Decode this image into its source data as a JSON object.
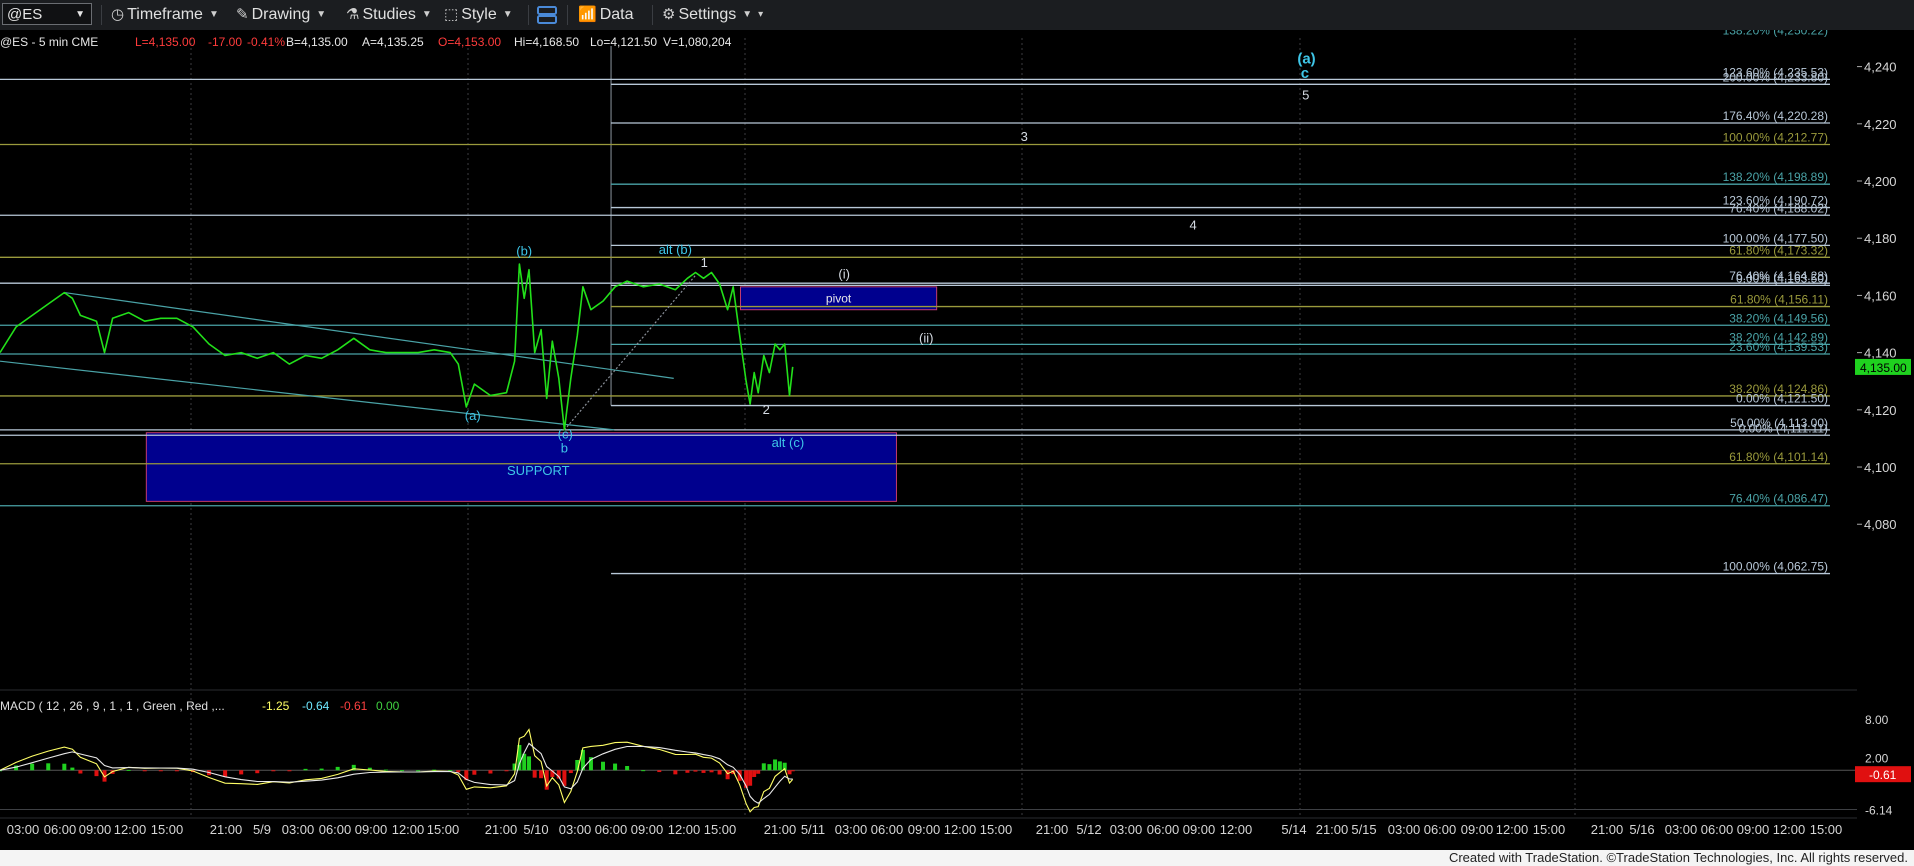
{
  "toolbar": {
    "symbol": "@ES",
    "items": [
      {
        "label": "Timeframe",
        "icon": "clock-icon",
        "has_caret": true
      },
      {
        "label": "Drawing",
        "icon": "pencil-icon",
        "has_caret": true
      },
      {
        "label": "Studies",
        "icon": "flask-icon",
        "has_caret": true
      },
      {
        "label": "Style",
        "icon": "style-icon",
        "has_caret": true
      },
      {
        "label": "",
        "icon": "layout-icon",
        "has_caret": false
      },
      {
        "label": "Data",
        "icon": "bar-chart-icon",
        "has_caret": false
      },
      {
        "label": "Settings",
        "icon": "gear-icon",
        "has_caret": true
      }
    ]
  },
  "header": {
    "symbol_info": "@ES - 5 min  CME",
    "L": "L=4,135.00",
    "chg": "-17.00",
    "pct": "-0.41%",
    "B": "B=4,135.00",
    "A": "A=4,135.25",
    "O": "O=4,153.00",
    "Hi": "Hi=4,168.50",
    "Lo": "Lo=4,121.50",
    "V": "V=1,080,204"
  },
  "colors": {
    "price": "#22e01a",
    "wave_label": "#3ec6e8",
    "box_fill": "#00008e",
    "box_border": "#c43b6e",
    "fib_olive": "#9a9a3c",
    "fib_teal": "#4aa3a7",
    "fib_white": "#b8c8d8",
    "last_price_bg": "#1fd11f",
    "macd_neg_bg": "#e01010"
  },
  "chart_data": {
    "type": "line",
    "instrument": "@ES - 5 min CME",
    "ylim": [
      4062,
      4246
    ],
    "y_ticks": [
      4080,
      4100,
      4120,
      4140,
      4160,
      4180,
      4200,
      4220,
      4240
    ],
    "last_price": "4,135.00",
    "x_tick_labels": [
      "03:00",
      "06:00",
      "09:00",
      "12:00",
      "15:00",
      "21:00",
      "5/9",
      "03:00",
      "06:00",
      "09:00",
      "12:00",
      "15:00",
      "21:00",
      "5/10",
      "03:00",
      "06:00",
      "09:00",
      "12:00",
      "15:00",
      "21:00",
      "5/11",
      "03:00",
      "06:00",
      "09:00",
      "12:00",
      "15:00",
      "21:00",
      "5/12",
      "03:00",
      "06:00",
      "09:00",
      "12:00",
      "5/14",
      "21:00",
      "5/15",
      "03:00",
      "06:00",
      "09:00",
      "12:00",
      "15:00",
      "21:00",
      "5/16",
      "03:00",
      "06:00",
      "09:00",
      "12:00",
      "15:00"
    ],
    "price_path": [
      {
        "t": 0,
        "p": 4140
      },
      {
        "t": 2,
        "p": 4149
      },
      {
        "t": 4,
        "p": 4153
      },
      {
        "t": 6,
        "p": 4157
      },
      {
        "t": 8,
        "p": 4161
      },
      {
        "t": 9,
        "p": 4159
      },
      {
        "t": 10,
        "p": 4153
      },
      {
        "t": 12,
        "p": 4151
      },
      {
        "t": 13,
        "p": 4140
      },
      {
        "t": 14,
        "p": 4152
      },
      {
        "t": 16,
        "p": 4154
      },
      {
        "t": 18,
        "p": 4151
      },
      {
        "t": 20,
        "p": 4152
      },
      {
        "t": 22,
        "p": 4152
      },
      {
        "t": 24,
        "p": 4149
      },
      {
        "t": 26,
        "p": 4143
      },
      {
        "t": 28,
        "p": 4139
      },
      {
        "t": 30,
        "p": 4140
      },
      {
        "t": 32,
        "p": 4138
      },
      {
        "t": 34,
        "p": 4140
      },
      {
        "t": 36,
        "p": 4136
      },
      {
        "t": 38,
        "p": 4139
      },
      {
        "t": 40,
        "p": 4138
      },
      {
        "t": 42,
        "p": 4141
      },
      {
        "t": 44,
        "p": 4145
      },
      {
        "t": 46,
        "p": 4141
      },
      {
        "t": 48,
        "p": 4140
      },
      {
        "t": 50,
        "p": 4140
      },
      {
        "t": 52,
        "p": 4140
      },
      {
        "t": 54,
        "p": 4141
      },
      {
        "t": 56,
        "p": 4140
      },
      {
        "t": 57,
        "p": 4136
      },
      {
        "t": 58,
        "p": 4121
      },
      {
        "t": 59,
        "p": 4129
      },
      {
        "t": 61,
        "p": 4125
      },
      {
        "t": 63,
        "p": 4126
      },
      {
        "t": 64,
        "p": 4137
      },
      {
        "t": 64.6,
        "p": 4171
      },
      {
        "t": 65.2,
        "p": 4159
      },
      {
        "t": 65.8,
        "p": 4169
      },
      {
        "t": 66.5,
        "p": 4140
      },
      {
        "t": 67.3,
        "p": 4148
      },
      {
        "t": 68,
        "p": 4124
      },
      {
        "t": 68.7,
        "p": 4144
      },
      {
        "t": 69.5,
        "p": 4131
      },
      {
        "t": 70.2,
        "p": 4113
      },
      {
        "t": 71,
        "p": 4131
      },
      {
        "t": 71.8,
        "p": 4146
      },
      {
        "t": 72.5,
        "p": 4163
      },
      {
        "t": 73.5,
        "p": 4155
      },
      {
        "t": 75,
        "p": 4158
      },
      {
        "t": 76.5,
        "p": 4163
      },
      {
        "t": 78,
        "p": 4165
      },
      {
        "t": 80,
        "p": 4163
      },
      {
        "t": 82,
        "p": 4164
      },
      {
        "t": 84,
        "p": 4162
      },
      {
        "t": 85.5,
        "p": 4166
      },
      {
        "t": 86.5,
        "p": 4168
      },
      {
        "t": 87.5,
        "p": 4166
      },
      {
        "t": 88.5,
        "p": 4168
      },
      {
        "t": 89.5,
        "p": 4164
      },
      {
        "t": 90.5,
        "p": 4155
      },
      {
        "t": 91.2,
        "p": 4163
      },
      {
        "t": 92,
        "p": 4146
      },
      {
        "t": 92.8,
        "p": 4130
      },
      {
        "t": 93.3,
        "p": 4122
      },
      {
        "t": 93.8,
        "p": 4133
      },
      {
        "t": 94.3,
        "p": 4126
      },
      {
        "t": 95,
        "p": 4139
      },
      {
        "t": 95.7,
        "p": 4133
      },
      {
        "t": 96.4,
        "p": 4143
      },
      {
        "t": 97,
        "p": 4141
      },
      {
        "t": 97.6,
        "p": 4143
      },
      {
        "t": 98.2,
        "p": 4125
      },
      {
        "t": 98.6,
        "p": 4135
      }
    ],
    "fib_levels": [
      {
        "label": "138.20% (4,250.22)",
        "value": 4250.22,
        "color": "teal",
        "x_from": 76
      },
      {
        "label": "123.60% (4,235.53)",
        "value": 4235.53,
        "color": "white",
        "x_from": 0
      },
      {
        "label": "200.00% (4,233.80)",
        "value": 4233.8,
        "color": "white",
        "x_from": 76
      },
      {
        "label": "176.40% (4,220.28)",
        "value": 4220.28,
        "color": "white",
        "x_from": 76
      },
      {
        "label": "100.00% (4,212.77)",
        "value": 4212.77,
        "color": "olive",
        "x_from": 0
      },
      {
        "label": "138.20% (4,198.89)",
        "value": 4198.89,
        "color": "teal",
        "x_from": 76
      },
      {
        "label": "123.60% (4,190.72)",
        "value": 4190.72,
        "color": "white",
        "x_from": 76
      },
      {
        "label": "76.40% (4,188.02)",
        "value": 4188.02,
        "color": "white",
        "x_from": 0
      },
      {
        "label": "100.00% (4,177.50)",
        "value": 4177.5,
        "color": "white",
        "x_from": 76
      },
      {
        "label": "61.80% (4,173.32)",
        "value": 4173.32,
        "color": "olive",
        "x_from": 0
      },
      {
        "label": "76.40% (4,164.28)",
        "value": 4164.28,
        "color": "white",
        "x_from": 0
      },
      {
        "label": "0.00% (4,163.50)",
        "value": 4163.5,
        "color": "white",
        "x_from": 76
      },
      {
        "label": "61.80% (4,156.11)",
        "value": 4156.11,
        "color": "olive",
        "x_from": 76
      },
      {
        "label": "38.20% (4,149.56)",
        "value": 4149.56,
        "color": "teal",
        "x_from": 0
      },
      {
        "label": "38.20% (4,142.89)",
        "value": 4142.89,
        "color": "teal",
        "x_from": 76
      },
      {
        "label": "23.60% (4,139.53)",
        "value": 4139.53,
        "color": "teal",
        "x_from": 0
      },
      {
        "label": "38.20% (4,124.86)",
        "value": 4124.86,
        "color": "olive",
        "x_from": 0
      },
      {
        "label": "0.00% (4,121.50)",
        "value": 4121.5,
        "color": "white",
        "x_from": 76
      },
      {
        "label": "50.00% (4,113.00)",
        "value": 4113.0,
        "color": "white",
        "x_from": 0
      },
      {
        "label": "0.00% (4,111.11)",
        "value": 4111.11,
        "color": "white",
        "x_from": 0
      },
      {
        "label": "61.80% (4,101.14)",
        "value": 4101.14,
        "color": "olive",
        "x_from": 0
      },
      {
        "label": "76.40% (4,086.47)",
        "value": 4086.47,
        "color": "teal",
        "x_from": 0
      },
      {
        "label": "100.00% (4,062.75)",
        "value": 4062.75,
        "color": "white",
        "x_from": 76
      }
    ],
    "zones": [
      {
        "label": "SUPPORT",
        "x1": 18.2,
        "x2": 111.5,
        "y_top": 4112,
        "y_bottom": 4088
      },
      {
        "label": "pivot",
        "x1": 92.1,
        "x2": 116.5,
        "y_top": 4163,
        "y_bottom": 4155
      }
    ],
    "wave_labels": [
      {
        "text": "(b)",
        "t": 65.2,
        "p": 4174
      },
      {
        "text": "(a)",
        "t": 58.8,
        "p": 4116.5
      },
      {
        "text": "(c)",
        "t": 70.3,
        "p": 4110
      },
      {
        "text": "b",
        "t": 70.2,
        "p": 4105
      },
      {
        "text": "alt (b)",
        "t": 84,
        "p": 4174.5
      },
      {
        "text": "1",
        "t": 87.6,
        "p": 4170
      },
      {
        "text": "2",
        "t": 95.3,
        "p": 4118.5
      },
      {
        "text": "(i)",
        "t": 105,
        "p": 4166
      },
      {
        "text": "(ii)",
        "t": 115.2,
        "p": 4143.5
      },
      {
        "text": "alt (c)",
        "t": 98,
        "p": 4107
      },
      {
        "text": "3",
        "t": 127.4,
        "p": 4214
      },
      {
        "text": "4",
        "t": 148.4,
        "p": 4183
      },
      {
        "text": "(a)",
        "t": 162.5,
        "p": 4241
      },
      {
        "text": "c",
        "t": 162.3,
        "p": 4236
      },
      {
        "text": "5",
        "t": 162.4,
        "p": 4228.5
      }
    ],
    "trendlines": [
      {
        "t1": 8,
        "p1": 4161,
        "t2": 83.8,
        "p2": 4131
      },
      {
        "t1": 0,
        "p1": 4137,
        "t2": 76.4,
        "p2": 4113
      },
      {
        "t1": 70.2,
        "p1": 4113,
        "t2": 86.5,
        "p2": 4167
      }
    ],
    "macd": {
      "label": "MACD ( 12 , 26 , 9 , 1 , 1 , Green , Red ,...",
      "values": [
        "-1.25",
        "-0.64",
        "-0.61",
        "0.00"
      ],
      "ylim": [
        -7,
        11
      ],
      "y_ticks": [
        "8.00",
        "2.00",
        "-0.61",
        "-6.14"
      ]
    }
  },
  "footer": {
    "credit": "Created with TradeStation. ©TradeStation Technologies, Inc. All rights reserved."
  }
}
